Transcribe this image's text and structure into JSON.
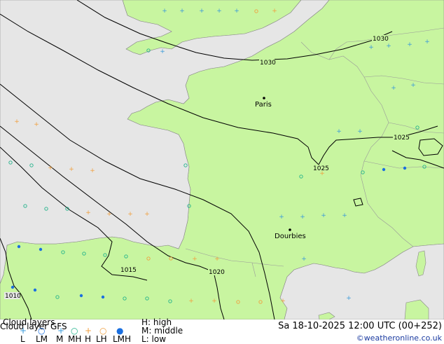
{
  "map": {
    "cities": [
      {
        "name": "Paris"
      },
      {
        "name": "Dourbies"
      }
    ],
    "isobars": [
      {
        "value": "1030"
      },
      {
        "value": "1030"
      },
      {
        "value": "1025"
      },
      {
        "value": "1025"
      },
      {
        "value": "1020"
      },
      {
        "value": "1015"
      },
      {
        "value": "1010"
      }
    ],
    "colors": {
      "land": "#c8f5a0",
      "sea": "#e6e6e6",
      "isobar": "#000000",
      "high_cloud": "#3a9ad9",
      "middle_cloud": "#f0a040",
      "low_cloud": "#23b38b",
      "lm_cloud": "#1a6fe0"
    }
  },
  "footer": {
    "title": "Cloud layers",
    "subtitle": "Cloud layer GFS",
    "legend_symbols": [
      {
        "label": "L",
        "glyph": "+",
        "color": "#3a9ad9"
      },
      {
        "label": "LM",
        "glyph": "○",
        "color": "#1a6fe0"
      },
      {
        "label": "M",
        "glyph": "+",
        "color": "#3a9ad9"
      },
      {
        "label": "MH",
        "glyph": "○",
        "color": "#23b38b"
      },
      {
        "label": "H",
        "glyph": "+",
        "color": "#f0a040"
      },
      {
        "label": "LH",
        "glyph": "○",
        "color": "#f0a040"
      },
      {
        "label": "LMH",
        "glyph": "●",
        "color": "#1a6fe0"
      }
    ],
    "key": {
      "high": "H: high",
      "middle": "M: middle",
      "low": "L: low"
    },
    "datetime": "Sa 18-10-2025 12:00 UTC (00+252)",
    "credit": "©weatheronline.co.uk"
  }
}
